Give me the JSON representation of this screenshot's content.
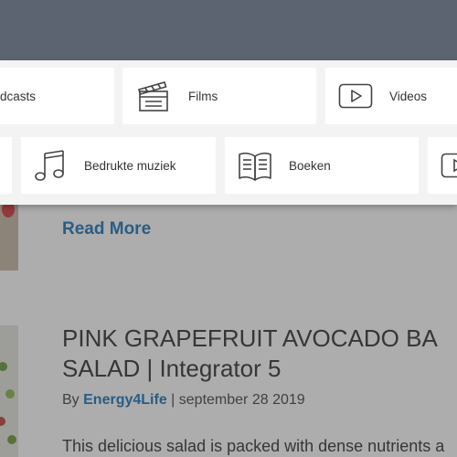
{
  "menu": {
    "items": [
      {
        "label": "dcasts",
        "icon": "podcast-icon"
      },
      {
        "label": "Films",
        "icon": "clapperboard-icon"
      },
      {
        "label": "Videos",
        "icon": "play-icon"
      },
      {
        "label": "Bedrukte muziek",
        "icon": "music-note-icon"
      },
      {
        "label": "Boeken",
        "icon": "open-book-icon"
      },
      {
        "label": "",
        "icon": "play-icon"
      }
    ]
  },
  "article": {
    "read_more": "Read More",
    "post_title_line1": "PINK GRAPEFRUIT AVOCADO BA",
    "post_title_line2": "SALAD | Integrator 5",
    "meta_by": "By",
    "author": "Energy4Life",
    "meta_sep": "|",
    "date": "september 28 2019",
    "excerpt": "This delicious salad is packed with dense nutrients a"
  },
  "colors": {
    "header": "#5b6470",
    "link": "#1c75b8",
    "overlay": "rgba(60,60,60,0.42)"
  }
}
